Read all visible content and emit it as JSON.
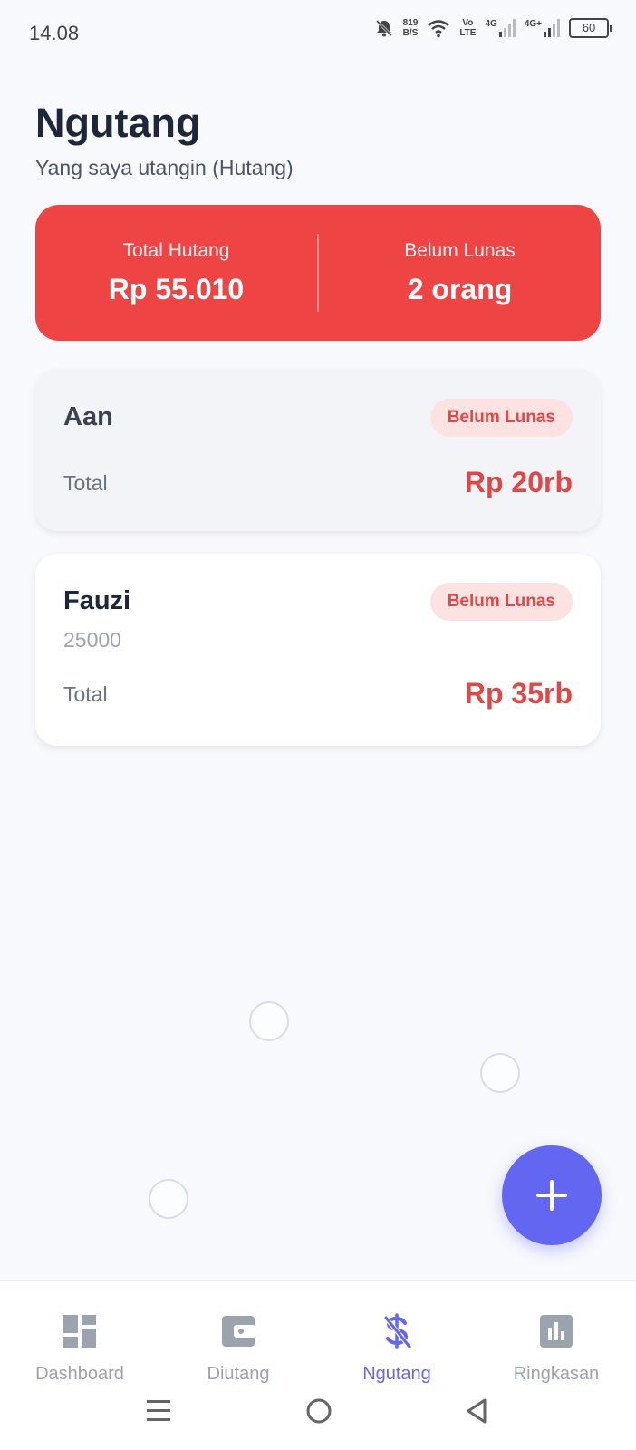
{
  "status_bar": {
    "time": "14.08",
    "speed_value": "819",
    "speed_unit": "B/S",
    "volte_top": "Vo",
    "volte_bottom": "LTE",
    "network_1": "4G",
    "network_2": "4G+",
    "battery": "60"
  },
  "header": {
    "title": "Ngutang",
    "subtitle": "Yang saya utangin (Hutang)"
  },
  "summary": {
    "total_label": "Total Hutang",
    "total_value": "Rp 55.010",
    "unpaid_label": "Belum Lunas",
    "unpaid_value": "2 orang",
    "color": "#ef4444"
  },
  "debts": [
    {
      "name": "Aan",
      "status": "Belum Lunas",
      "note": "",
      "total_label": "Total",
      "total_value": "Rp 20rb"
    },
    {
      "name": "Fauzi",
      "status": "Belum Lunas",
      "note": "25000",
      "total_label": "Total",
      "total_value": "Rp 35rb"
    }
  ],
  "fab": {
    "icon": "plus-icon",
    "color": "#6366f1"
  },
  "bottom_nav": {
    "items": [
      {
        "label": "Dashboard",
        "icon": "dashboard-icon",
        "active": false
      },
      {
        "label": "Diutang",
        "icon": "wallet-icon",
        "active": false
      },
      {
        "label": "Ngutang",
        "icon": "dollar-icon",
        "active": true
      },
      {
        "label": "Ringkasan",
        "icon": "bar-chart-icon",
        "active": false
      }
    ]
  },
  "system_nav": {
    "icons": [
      "menu-icon",
      "home-icon",
      "back-icon"
    ]
  }
}
